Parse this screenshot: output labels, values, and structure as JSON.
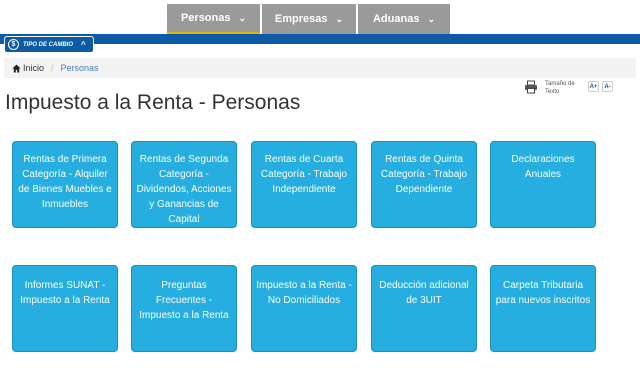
{
  "nav": {
    "tabs": [
      {
        "label": "Personas"
      },
      {
        "label": "Empresas"
      },
      {
        "label": "Aduanas"
      }
    ],
    "chevron": "⌄"
  },
  "tipo_cambio": {
    "icon_text": "$",
    "label": "TIPO DE CAMBIO",
    "caret": "^"
  },
  "breadcrumb": {
    "home_label": "Inicio",
    "separator": "/",
    "current": "Personas"
  },
  "tools": {
    "text_size_label": "Tamaño de Texto",
    "increase": "A+",
    "decrease": "A-"
  },
  "page_title": "Impuesto a la Renta - Personas",
  "cards": [
    {
      "label": "Rentas de Primera Categoría - Alquiler de Bienes Muebles e Inmuebles"
    },
    {
      "label": "Rentas de Segunda Categoría - Dividendos, Acciones y Ganancias de Capital"
    },
    {
      "label": "Rentas de Cuarta Categoría - Trabajo Independiente"
    },
    {
      "label": "Rentas de Quinta Categoría - Trabajo Dependiente"
    },
    {
      "label": "Declaraciones Anuales"
    },
    {
      "label": "Informes SUNAT - Impuesto a la Renta"
    },
    {
      "label": "Preguntas Frecuentes - Impuesto a la Renta"
    },
    {
      "label": "Impuesto a la Renta - No Domiciliados"
    },
    {
      "label": "Deducción adicional de 3UIT"
    },
    {
      "label": "Carpeta Tributaria para nuevos inscritos"
    }
  ],
  "colors": {
    "brand_blue": "#0d5aa7",
    "card_blue": "#26aee1",
    "nav_gray": "#9a9a9a",
    "active_underline": "#e3b400"
  }
}
